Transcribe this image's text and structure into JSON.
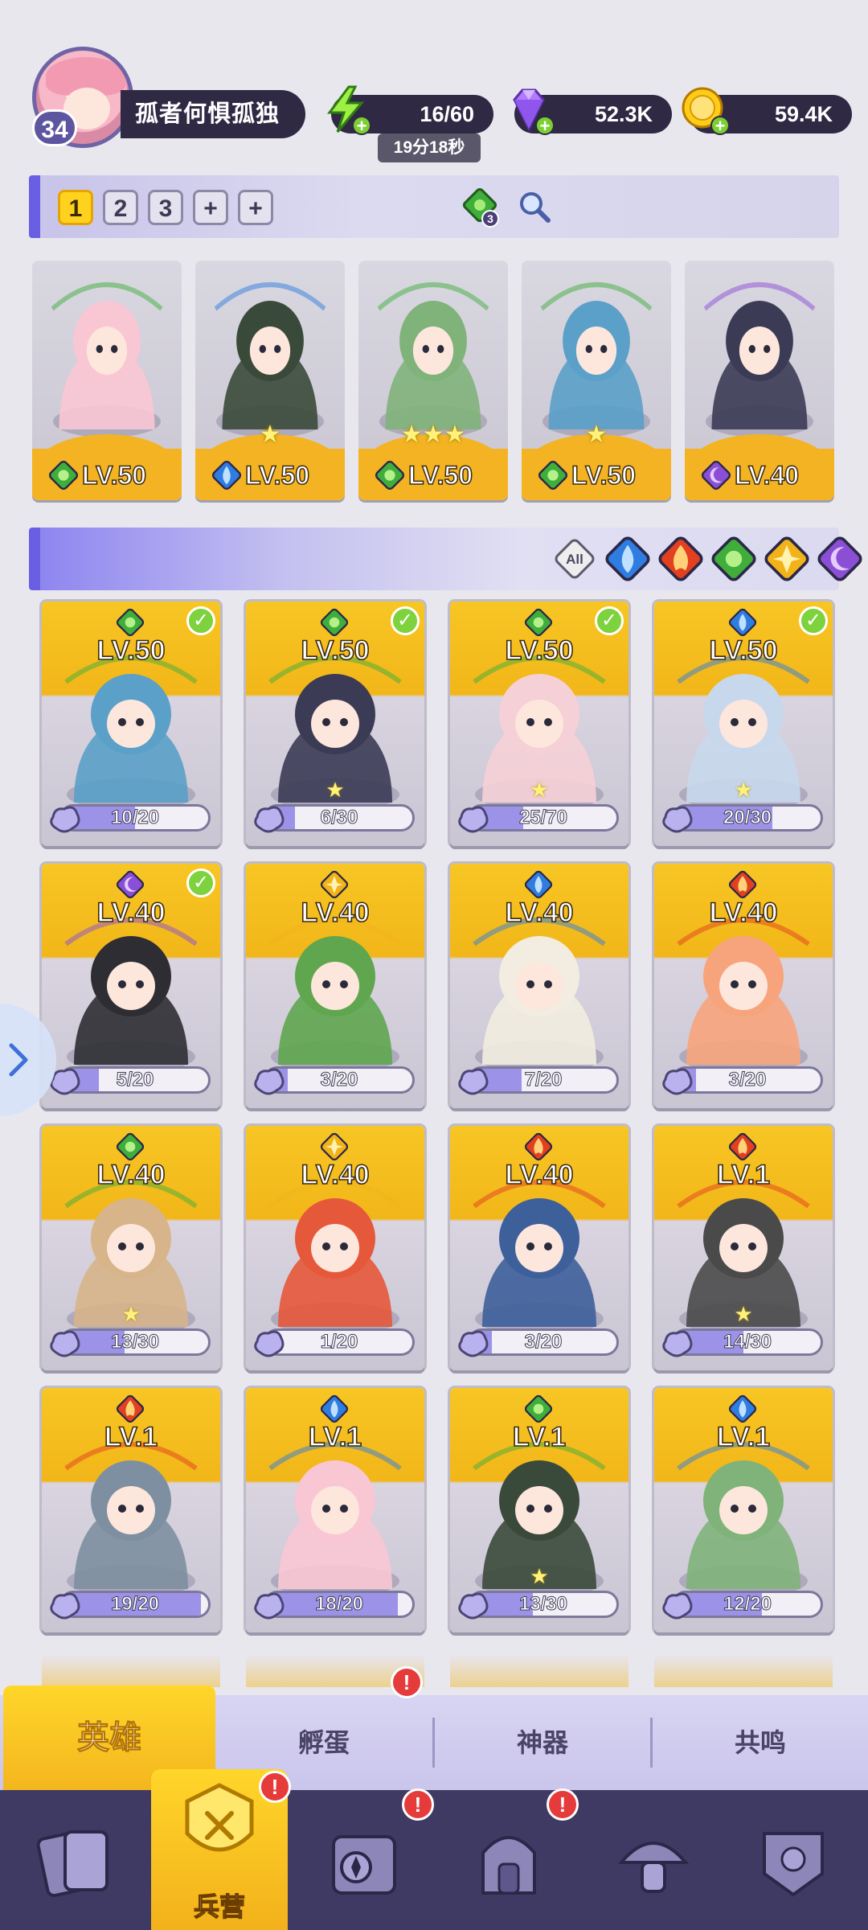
{
  "player": {
    "level": "34",
    "name": "孤者何惧孤独"
  },
  "resources": {
    "energy": "16/60",
    "energy_timer": "19分18秒",
    "gems": "52.3K",
    "gold": "59.4K"
  },
  "team_tabs": [
    "1",
    "2",
    "3"
  ],
  "team_bar": {
    "clover_count": "3"
  },
  "team": [
    {
      "level": "LV.50",
      "element": "nature",
      "stars": ""
    },
    {
      "level": "LV.50",
      "element": "water",
      "stars": "★"
    },
    {
      "level": "LV.50",
      "element": "nature",
      "stars": "★★★"
    },
    {
      "level": "LV.50",
      "element": "nature",
      "stars": "★"
    },
    {
      "level": "LV.40",
      "element": "dark",
      "stars": ""
    }
  ],
  "filters": {
    "all_label": "All",
    "elements": [
      "water",
      "fire",
      "nature",
      "light",
      "dark"
    ]
  },
  "heroes": [
    {
      "level": "LV.50",
      "element": "nature",
      "shards": "10/20",
      "fill": 0.5,
      "in_team": true,
      "star": false
    },
    {
      "level": "LV.50",
      "element": "nature",
      "shards": "6/30",
      "fill": 0.2,
      "in_team": true,
      "star": true
    },
    {
      "level": "LV.50",
      "element": "nature",
      "shards": "25/70",
      "fill": 0.357,
      "in_team": true,
      "star": true
    },
    {
      "level": "LV.50",
      "element": "water",
      "shards": "20/30",
      "fill": 0.667,
      "in_team": true,
      "star": true
    },
    {
      "level": "LV.40",
      "element": "dark",
      "shards": "5/20",
      "fill": 0.25,
      "in_team": true,
      "star": false
    },
    {
      "level": "LV.40",
      "element": "light",
      "shards": "3/20",
      "fill": 0.15,
      "in_team": false,
      "star": false
    },
    {
      "level": "LV.40",
      "element": "water",
      "shards": "7/20",
      "fill": 0.35,
      "in_team": false,
      "star": false
    },
    {
      "level": "LV.40",
      "element": "fire",
      "shards": "3/20",
      "fill": 0.15,
      "in_team": false,
      "star": false
    },
    {
      "level": "LV.40",
      "element": "nature",
      "shards": "13/30",
      "fill": 0.433,
      "in_team": false,
      "star": true
    },
    {
      "level": "LV.40",
      "element": "light",
      "shards": "1/20",
      "fill": 0.05,
      "in_team": false,
      "star": false
    },
    {
      "level": "LV.40",
      "element": "fire",
      "shards": "3/20",
      "fill": 0.15,
      "in_team": false,
      "star": false
    },
    {
      "level": "LV.1",
      "element": "fire",
      "shards": "14/30",
      "fill": 0.467,
      "in_team": false,
      "star": true
    },
    {
      "level": "LV.1",
      "element": "fire",
      "shards": "19/20",
      "fill": 0.95,
      "in_team": false,
      "star": false
    },
    {
      "level": "LV.1",
      "element": "water",
      "shards": "18/20",
      "fill": 0.9,
      "in_team": false,
      "star": false
    },
    {
      "level": "LV.1",
      "element": "nature",
      "shards": "13/30",
      "fill": 0.433,
      "in_team": false,
      "star": true
    },
    {
      "level": "LV.1",
      "element": "water",
      "shards": "12/20",
      "fill": 0.6,
      "in_team": false,
      "star": false
    }
  ],
  "subtabs": {
    "heroes": "英雄",
    "hatch": "孵蛋",
    "artifacts": "神器",
    "resonance": "共鸣"
  },
  "bottom_nav": {
    "barracks_label": "兵营",
    "items": [
      "cards-icon",
      "barracks-icon",
      "map-icon",
      "temple-icon",
      "mushroom-icon",
      "guild-icon"
    ]
  },
  "colors": {
    "accent_yellow": "#f4b61e",
    "nav_bg": "#3f3a63",
    "panel_purple": "#6a5fe3",
    "nature": "#3fae3b",
    "water": "#2f7de0",
    "fire": "#e2401f",
    "light": "#f2b319",
    "dark": "#8b4fd6"
  }
}
